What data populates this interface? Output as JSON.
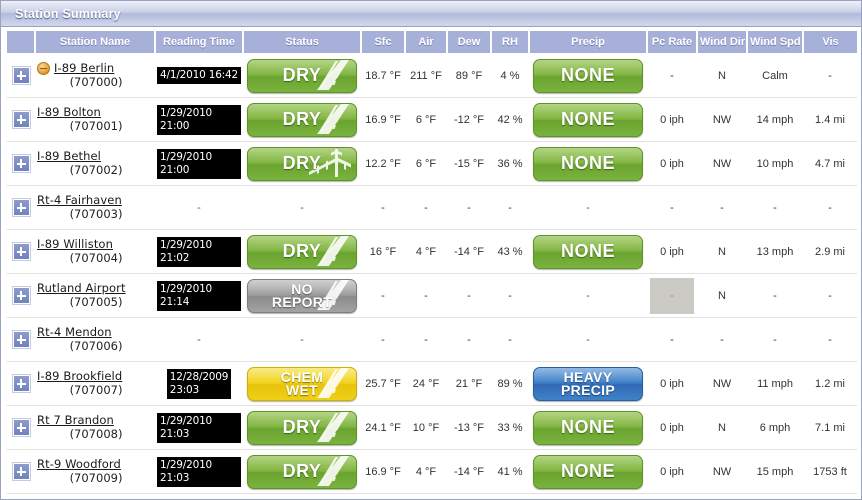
{
  "window": {
    "title": "Station Summary"
  },
  "table": {
    "columns": [
      {
        "key": "expand",
        "label": ""
      },
      {
        "key": "station",
        "label": "Station Name"
      },
      {
        "key": "reading",
        "label": "Reading Time"
      },
      {
        "key": "status",
        "label": "Status"
      },
      {
        "key": "sfc",
        "label": "Sfc"
      },
      {
        "key": "air",
        "label": "Air"
      },
      {
        "key": "dew",
        "label": "Dew"
      },
      {
        "key": "rh",
        "label": "RH"
      },
      {
        "key": "precip",
        "label": "Precip"
      },
      {
        "key": "pcrate",
        "label": "Pc Rate"
      },
      {
        "key": "winddir",
        "label": "Wind Dir"
      },
      {
        "key": "windspd",
        "label": "Wind Spd"
      },
      {
        "key": "vis",
        "label": "Vis"
      }
    ],
    "expand_icon": "plus-icon",
    "rows": [
      {
        "station_name": "I-89 Berlin",
        "station_id": "(707000)",
        "stale_icon": "stale-clock-icon",
        "reading_time": "4/1/2010 16:42",
        "status_label": "DRY",
        "status_color": "green",
        "status_glyph": "road-icon",
        "sfc": "18.7 °F",
        "air": "211 °F",
        "dew": "89 °F",
        "rh": "4 %",
        "precip_label": "NONE",
        "precip_color": "green",
        "pc_rate": "-",
        "wind_dir": "N",
        "wind_spd": "Calm",
        "vis": "-"
      },
      {
        "station_name": "I-89 Bolton",
        "station_id": "(707001)",
        "stale_icon": null,
        "reading_time": "1/29/2010 21:00",
        "status_label": "DRY",
        "status_color": "green",
        "status_glyph": "road-icon",
        "sfc": "16.9 °F",
        "air": "6 °F",
        "dew": "-12 °F",
        "rh": "42 %",
        "precip_label": "NONE",
        "precip_color": "green",
        "pc_rate": "0 iph",
        "wind_dir": "NW",
        "wind_spd": "14 mph",
        "vis": "1.4 mi"
      },
      {
        "station_name": "I-89 Bethel",
        "station_id": "(707002)",
        "stale_icon": null,
        "reading_time": "1/29/2010 21:00",
        "status_label": "DRY",
        "status_color": "green",
        "status_glyph": "bridge-icon",
        "sfc": "12.2 °F",
        "air": "6 °F",
        "dew": "-15 °F",
        "rh": "36 %",
        "precip_label": "NONE",
        "precip_color": "green",
        "pc_rate": "0 iph",
        "wind_dir": "NW",
        "wind_spd": "10 mph",
        "vis": "4.7 mi"
      },
      {
        "station_name": "Rt-4 Fairhaven",
        "station_id": "(707003)",
        "stale_icon": null,
        "reading_time": "-",
        "status_label": "-",
        "status_color": "none",
        "status_glyph": null,
        "sfc": "-",
        "air": "-",
        "dew": "-",
        "rh": "-",
        "precip_label": "-",
        "precip_color": "none",
        "pc_rate": "-",
        "wind_dir": "-",
        "wind_spd": "-",
        "vis": "-"
      },
      {
        "station_name": "I-89 Williston",
        "station_id": "(707004)",
        "stale_icon": null,
        "reading_time": "1/29/2010 21:02",
        "status_label": "DRY",
        "status_color": "green",
        "status_glyph": "road-icon",
        "sfc": "16 °F",
        "air": "4 °F",
        "dew": "-14 °F",
        "rh": "43 %",
        "precip_label": "NONE",
        "precip_color": "green",
        "pc_rate": "0 iph",
        "wind_dir": "N",
        "wind_spd": "13 mph",
        "vis": "2.9 mi"
      },
      {
        "station_name": "Rutland Airport",
        "station_id": "(707005)",
        "stale_icon": null,
        "reading_time": "1/29/2010 21:14",
        "status_label": "NO\nREPORT",
        "status_color": "grey",
        "status_glyph": "road-icon",
        "sfc": "-",
        "air": "-",
        "dew": "-",
        "rh": "-",
        "precip_label": "-",
        "precip_color": "placeholder",
        "pc_rate": "-",
        "pc_rate_placeholder": true,
        "wind_dir": "N",
        "wind_spd": "-",
        "vis": "-"
      },
      {
        "station_name": "Rt-4 Mendon",
        "station_id": "(707006)",
        "stale_icon": null,
        "reading_time": "-",
        "status_label": "-",
        "status_color": "none",
        "status_glyph": null,
        "sfc": "-",
        "air": "-",
        "dew": "-",
        "rh": "-",
        "precip_label": "-",
        "precip_color": "none",
        "pc_rate": "-",
        "wind_dir": "-",
        "wind_spd": "-",
        "vis": "-"
      },
      {
        "station_name": "I-89 Brookfield",
        "station_id": "(707007)",
        "stale_icon": null,
        "reading_time": "12/28/2009\n23:03",
        "status_label": "CHEM\nWET",
        "status_color": "yellow",
        "status_glyph": "road-icon",
        "sfc": "25.7 °F",
        "air": "24 °F",
        "dew": "21 °F",
        "rh": "89 %",
        "precip_label": "HEAVY\nPRECIP",
        "precip_color": "blue",
        "pc_rate": "0 iph",
        "wind_dir": "NW",
        "wind_spd": "11 mph",
        "vis": "1.2 mi"
      },
      {
        "station_name": "Rt 7 Brandon",
        "station_id": "(707008)",
        "stale_icon": null,
        "reading_time": "1/29/2010 21:03",
        "status_label": "DRY",
        "status_color": "green",
        "status_glyph": "road-icon",
        "sfc": "24.1 °F",
        "air": "10 °F",
        "dew": "-13 °F",
        "rh": "33 %",
        "precip_label": "NONE",
        "precip_color": "green",
        "pc_rate": "0 iph",
        "wind_dir": "N",
        "wind_spd": "6 mph",
        "vis": "7.1 mi"
      },
      {
        "station_name": "Rt-9 Woodford",
        "station_id": "(707009)",
        "stale_icon": null,
        "reading_time": "1/29/2010 21:03",
        "status_label": "DRY",
        "status_color": "green",
        "status_glyph": "road-icon",
        "sfc": "16.9 °F",
        "air": "4 °F",
        "dew": "-14 °F",
        "rh": "41 %",
        "precip_label": "NONE",
        "precip_color": "green",
        "pc_rate": "0 iph",
        "wind_dir": "NW",
        "wind_spd": "15 mph",
        "vis": "1753 ft"
      }
    ]
  },
  "colors": {
    "header_bg": "#a6b0d8",
    "title_gradient_top": "#eef0f8",
    "title_gradient_bottom": "#b2bada",
    "status_green": "#7db23c",
    "status_grey": "#9a9a9a",
    "status_yellow": "#efd118",
    "status_blue": "#3a79c4",
    "led_bg": "#000000"
  }
}
